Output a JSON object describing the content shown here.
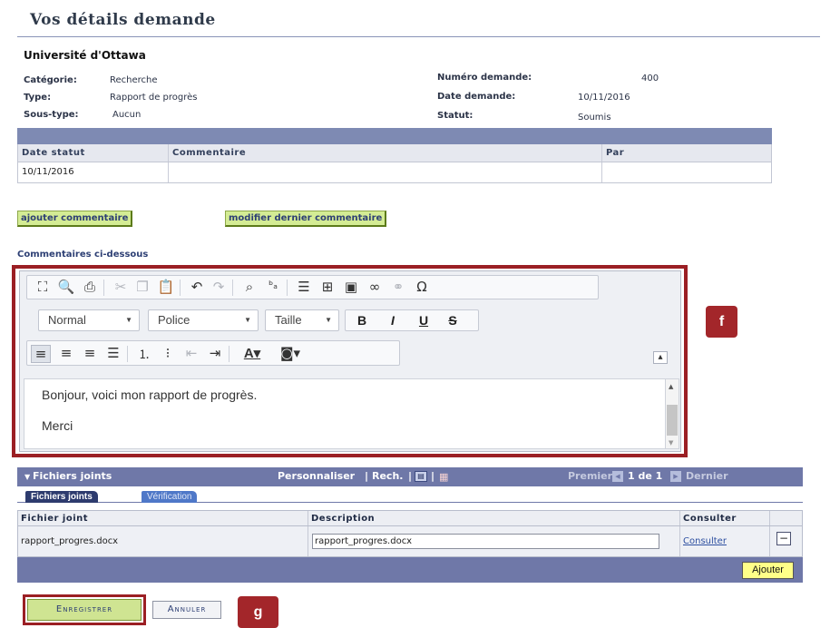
{
  "page_title": "Vos détails demande",
  "organization": "Université d'Ottawa",
  "info": {
    "category_label": "Catégorie:",
    "category_value": "Recherche",
    "type_label": "Type:",
    "type_value": "Rapport de progrès",
    "subtype_label": "Sous-type:",
    "subtype_value": "Aucun",
    "request_number_label": "Numéro demande:",
    "request_number_value": "400",
    "request_date_label": "Date demande:",
    "request_date_value": "10/11/2016",
    "status_label": "Statut:",
    "status_value": "Soumis"
  },
  "status_grid": {
    "columns": [
      "Date statut",
      "Commentaire",
      "Par"
    ],
    "rows": [
      [
        "10/11/2016",
        "",
        ""
      ]
    ]
  },
  "buttons": {
    "add_comment": "ajouter commentaire",
    "edit_last_comment": "modifier dernier commentaire",
    "save": "Enregistrer",
    "cancel": "Annuler",
    "add": "Ajouter"
  },
  "comments_label": "Commentaires ci-dessous",
  "editor": {
    "format_combo": "Normal",
    "font_combo": "Police",
    "size_combo": "Taille",
    "bold": "B",
    "italic": "I",
    "underline": "U",
    "strike": "S",
    "content_lines": [
      "Bonjour, voici mon rapport de progrès.",
      "Merci"
    ]
  },
  "callouts": {
    "f": "f",
    "g": "g"
  },
  "attachments": {
    "title": "Fichiers joints",
    "personalize": "Personnaliser",
    "search": "Rech.",
    "first": "Premier",
    "page_info": "1 de 1",
    "last": "Dernier",
    "tabs": [
      "Fichiers joints",
      "Vérification"
    ],
    "columns": [
      "Fichier joint",
      "Description",
      "Consulter"
    ],
    "rows": [
      {
        "file": "rapport_progres.docx",
        "description": "rapport_progres.docx",
        "view": "Consulter"
      }
    ]
  },
  "colors": {
    "header_band": "#6f78a8",
    "callout": "#a3262a",
    "green_button": "#d4ec94",
    "add_button": "#ffff88"
  }
}
